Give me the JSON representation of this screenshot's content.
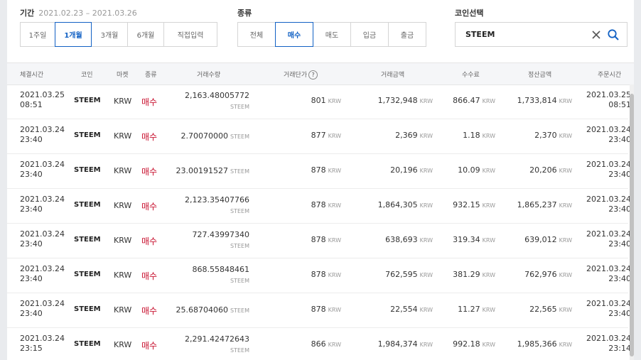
{
  "filters": {
    "period": {
      "label": "기간",
      "range": "2021.02.23 – 2021.03.26",
      "options": [
        "1주일",
        "1개월",
        "3개월",
        "6개월",
        "직접입력"
      ],
      "active_index": 1
    },
    "type": {
      "label": "종류",
      "options": [
        "전체",
        "매수",
        "매도",
        "입금",
        "출금"
      ],
      "active_index": 1
    },
    "coin": {
      "label": "코인선택",
      "value": "STEEM"
    }
  },
  "table": {
    "headers": {
      "time": "체결시간",
      "coin": "코인",
      "market": "마켓",
      "kind": "종류",
      "qty": "거래수량",
      "price": "거래단가",
      "amount": "거래금액",
      "fee": "수수료",
      "settle": "정산금액",
      "order_time": "주문시간"
    },
    "unit_krw": "KRW",
    "unit_coin": "STEEM",
    "rows": [
      {
        "date": "2021.03.25",
        "time": "08:51",
        "coin": "STEEM",
        "market": "KRW",
        "kind": "매수",
        "qty": "2,163.48005772",
        "price": "801",
        "amount": "1,732,948",
        "fee": "866.47",
        "settle": "1,733,814",
        "odate": "2021.03.25",
        "otime": "08:51",
        "qty_wrap": true
      },
      {
        "date": "2021.03.24",
        "time": "23:40",
        "coin": "STEEM",
        "market": "KRW",
        "kind": "매수",
        "qty": "2.70070000",
        "price": "877",
        "amount": "2,369",
        "fee": "1.18",
        "settle": "2,370",
        "odate": "2021.03.24",
        "otime": "23:40",
        "qty_wrap": false
      },
      {
        "date": "2021.03.24",
        "time": "23:40",
        "coin": "STEEM",
        "market": "KRW",
        "kind": "매수",
        "qty": "23.00191527",
        "price": "878",
        "amount": "20,196",
        "fee": "10.09",
        "settle": "20,206",
        "odate": "2021.03.24",
        "otime": "23:40",
        "qty_wrap": false
      },
      {
        "date": "2021.03.24",
        "time": "23:40",
        "coin": "STEEM",
        "market": "KRW",
        "kind": "매수",
        "qty": "2,123.35407766",
        "price": "878",
        "amount": "1,864,305",
        "fee": "932.15",
        "settle": "1,865,237",
        "odate": "2021.03.24",
        "otime": "23:40",
        "qty_wrap": true
      },
      {
        "date": "2021.03.24",
        "time": "23:40",
        "coin": "STEEM",
        "market": "KRW",
        "kind": "매수",
        "qty": "727.43997340",
        "price": "878",
        "amount": "638,693",
        "fee": "319.34",
        "settle": "639,012",
        "odate": "2021.03.24",
        "otime": "23:40",
        "qty_wrap": true
      },
      {
        "date": "2021.03.24",
        "time": "23:40",
        "coin": "STEEM",
        "market": "KRW",
        "kind": "매수",
        "qty": "868.55848461",
        "price": "878",
        "amount": "762,595",
        "fee": "381.29",
        "settle": "762,976",
        "odate": "2021.03.24",
        "otime": "23:40",
        "qty_wrap": true
      },
      {
        "date": "2021.03.24",
        "time": "23:40",
        "coin": "STEEM",
        "market": "KRW",
        "kind": "매수",
        "qty": "25.68704060",
        "price": "878",
        "amount": "22,554",
        "fee": "11.27",
        "settle": "22,565",
        "odate": "2021.03.24",
        "otime": "23:40",
        "qty_wrap": false
      },
      {
        "date": "2021.03.24",
        "time": "23:15",
        "coin": "STEEM",
        "market": "KRW",
        "kind": "매수",
        "qty": "2,291.42472643",
        "price": "866",
        "amount": "1,984,374",
        "fee": "992.18",
        "settle": "1,985,366",
        "odate": "2021.03.24",
        "otime": "23:14",
        "qty_wrap": true
      }
    ]
  }
}
